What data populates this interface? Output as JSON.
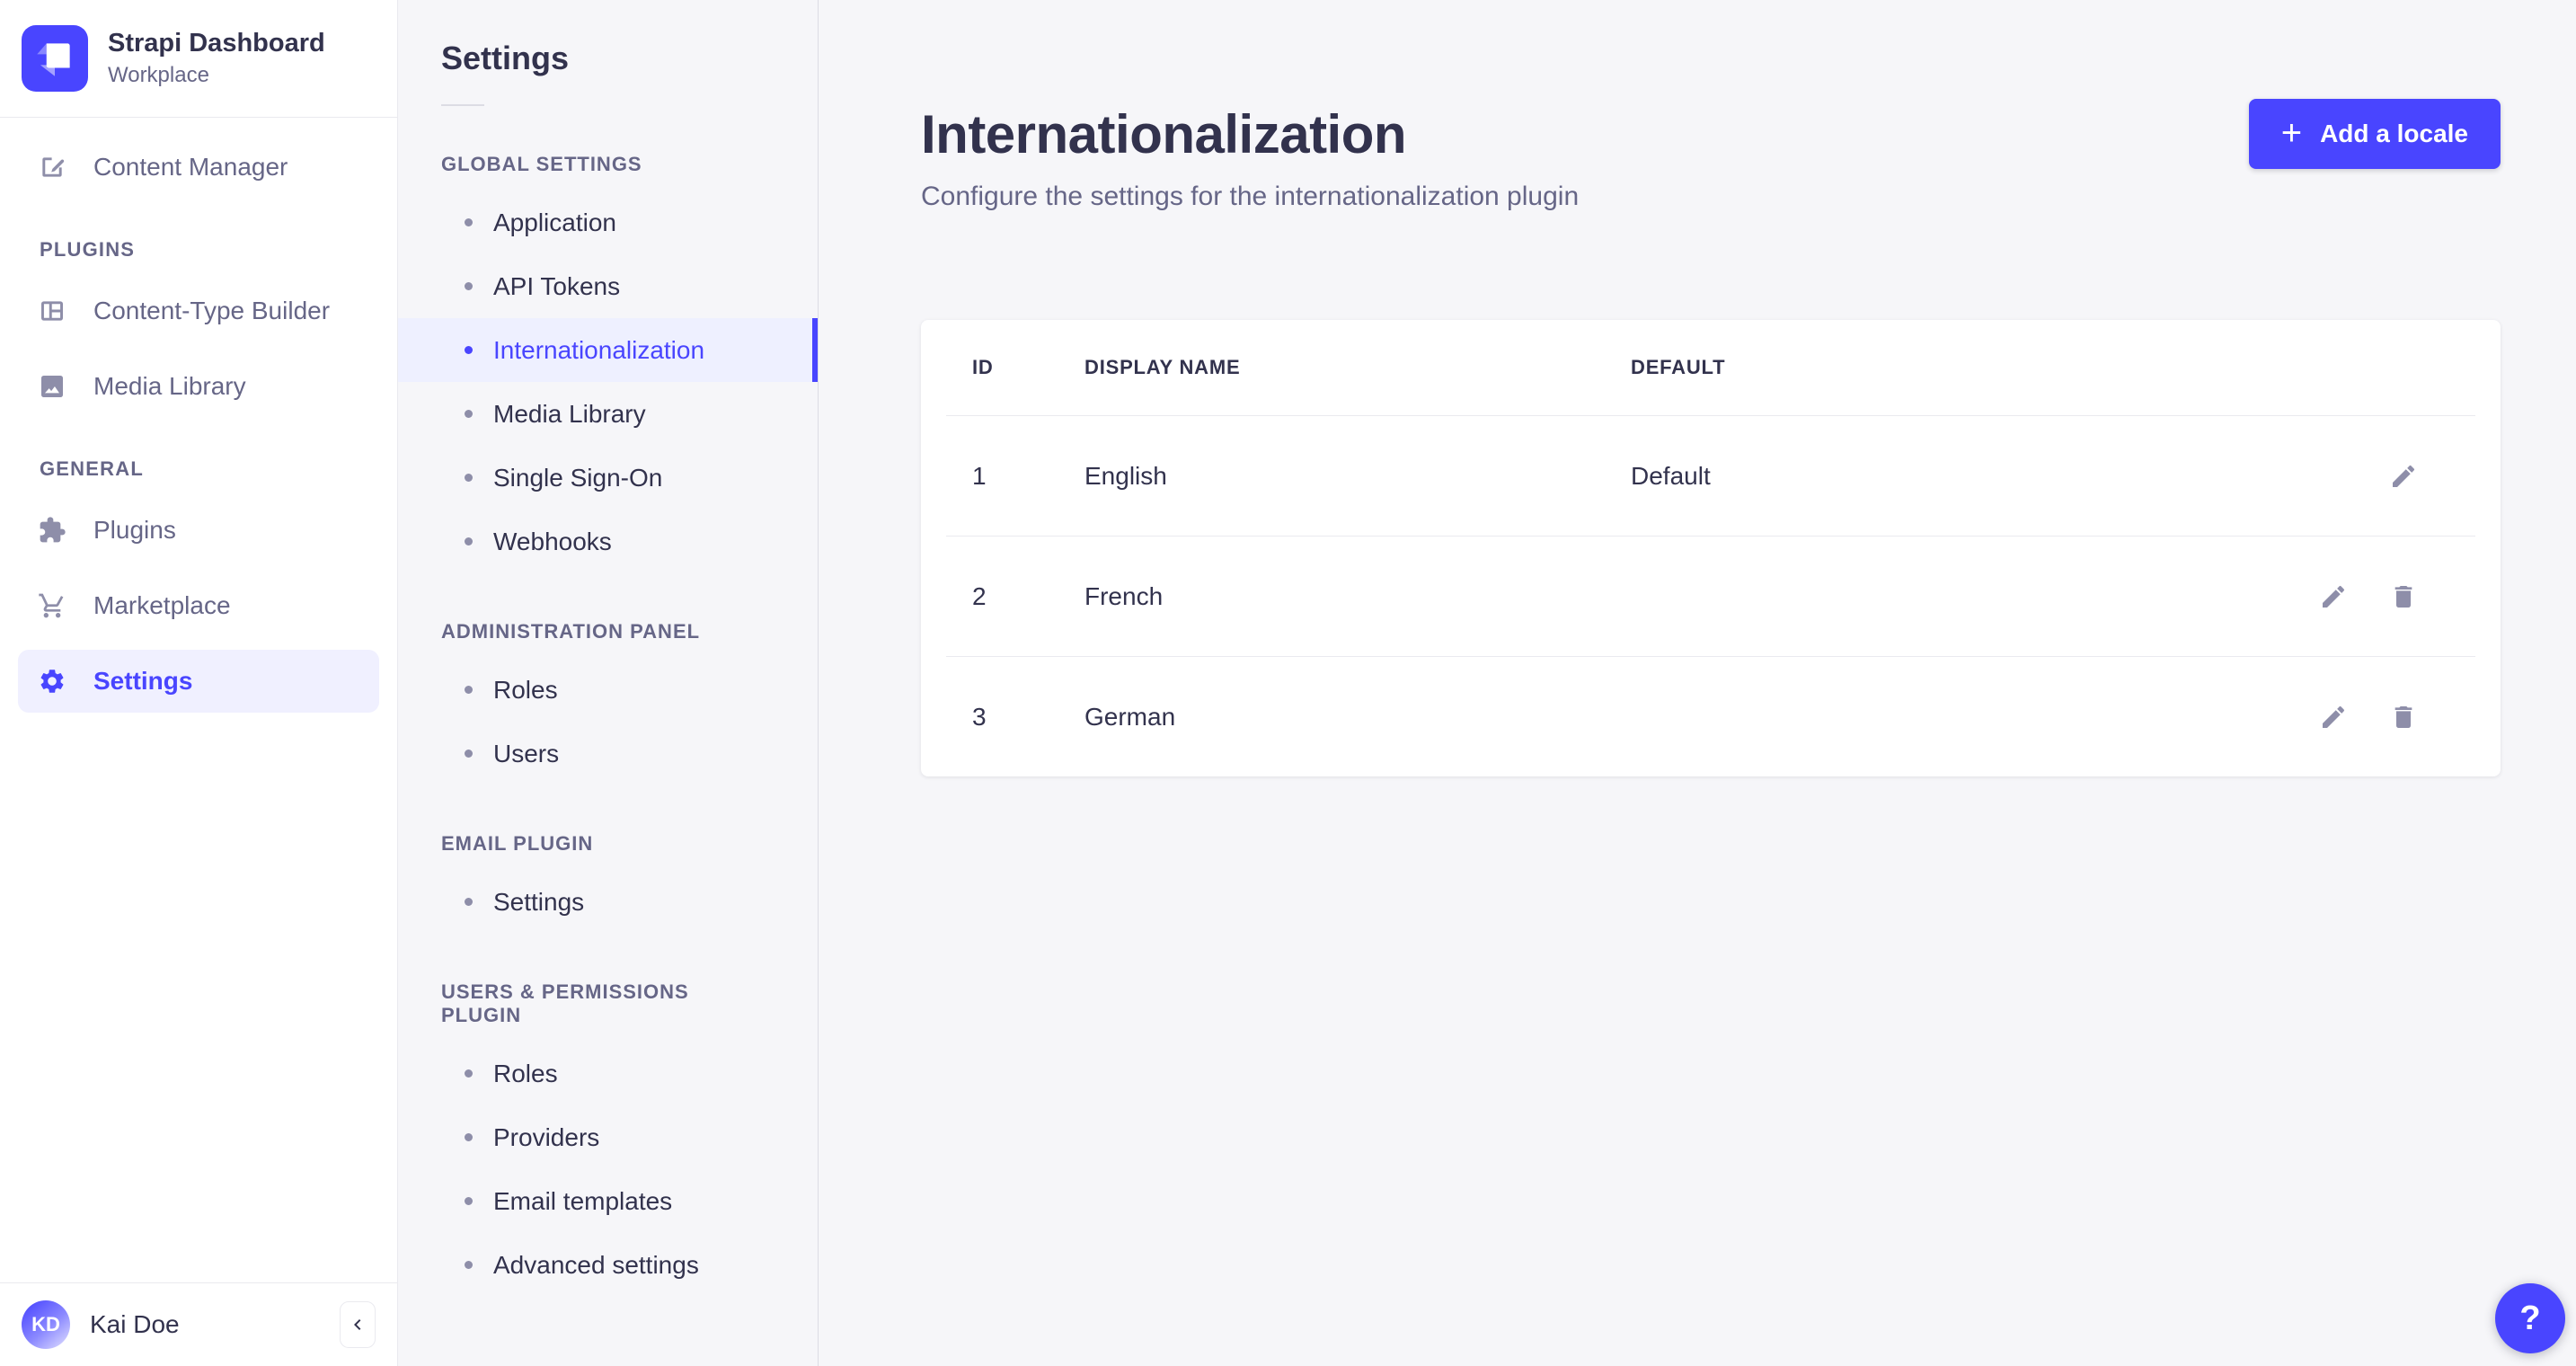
{
  "colors": {
    "accent": "#4945ff",
    "accent_bg": "#f0f0ff",
    "text_dark": "#32324d",
    "text_muted": "#666687",
    "icon_muted": "#8e8ea9",
    "page_bg": "#f6f6f9"
  },
  "brand": {
    "title": "Strapi Dashboard",
    "subtitle": "Workplace"
  },
  "sidebar": {
    "content_manager": {
      "label": "Content Manager",
      "icon": "content-manager-icon"
    },
    "sections": [
      {
        "label": "PLUGINS",
        "items": [
          {
            "label": "Content-Type Builder",
            "icon": "content-type-builder-icon"
          },
          {
            "label": "Media Library",
            "icon": "media-library-icon"
          }
        ]
      },
      {
        "label": "GENERAL",
        "items": [
          {
            "label": "Plugins",
            "icon": "plugins-puzzle-icon"
          },
          {
            "label": "Marketplace",
            "icon": "marketplace-cart-icon"
          },
          {
            "label": "Settings",
            "icon": "settings-gear-icon",
            "active": true
          }
        ]
      }
    ],
    "footer": {
      "initials": "KD",
      "name": "Kai Doe"
    }
  },
  "subnav": {
    "title": "Settings",
    "sections": [
      {
        "label": "GLOBAL SETTINGS",
        "items": [
          {
            "label": "Application"
          },
          {
            "label": "API Tokens"
          },
          {
            "label": "Internationalization",
            "active": true
          },
          {
            "label": "Media Library"
          },
          {
            "label": "Single Sign-On"
          },
          {
            "label": "Webhooks"
          }
        ]
      },
      {
        "label": "ADMINISTRATION PANEL",
        "items": [
          {
            "label": "Roles"
          },
          {
            "label": "Users"
          }
        ]
      },
      {
        "label": "EMAIL PLUGIN",
        "items": [
          {
            "label": "Settings"
          }
        ]
      },
      {
        "label": "USERS & PERMISSIONS PLUGIN",
        "items": [
          {
            "label": "Roles"
          },
          {
            "label": "Providers"
          },
          {
            "label": "Email templates"
          },
          {
            "label": "Advanced settings"
          }
        ]
      }
    ]
  },
  "page": {
    "title": "Internationalization",
    "subtitle": "Configure the settings for the internationalization plugin",
    "add_button": {
      "label": "Add a locale",
      "plus": "+"
    }
  },
  "table": {
    "headers": {
      "id": "ID",
      "display_name": "DISPLAY NAME",
      "default": "DEFAULT"
    },
    "rows": [
      {
        "id": "1",
        "display_name": "English",
        "default": "Default",
        "actions": [
          "edit"
        ]
      },
      {
        "id": "2",
        "display_name": "French",
        "default": "",
        "actions": [
          "edit",
          "delete"
        ]
      },
      {
        "id": "3",
        "display_name": "German",
        "default": "",
        "actions": [
          "edit",
          "delete"
        ]
      }
    ]
  },
  "help": {
    "label": "?"
  }
}
